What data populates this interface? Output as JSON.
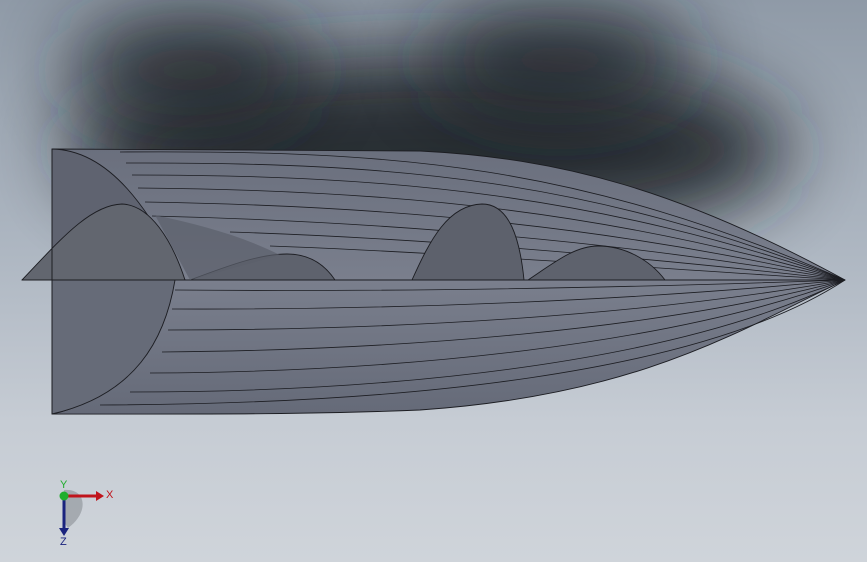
{
  "viewport": {
    "background_top": "#8f9aa7",
    "background_bottom": "#cfd4da",
    "shadow_color": "#20242a"
  },
  "model": {
    "face_color": "#6f7482",
    "face_light": "#7d8290",
    "face_dark": "#5a5e6a",
    "edge_color": "#1c1d22"
  },
  "triad": {
    "x_label": "X",
    "y_label": "Y",
    "z_label": "Z",
    "x_color": "#c0141c",
    "y_color": "#1fae2c",
    "z_color": "#1a237e"
  }
}
